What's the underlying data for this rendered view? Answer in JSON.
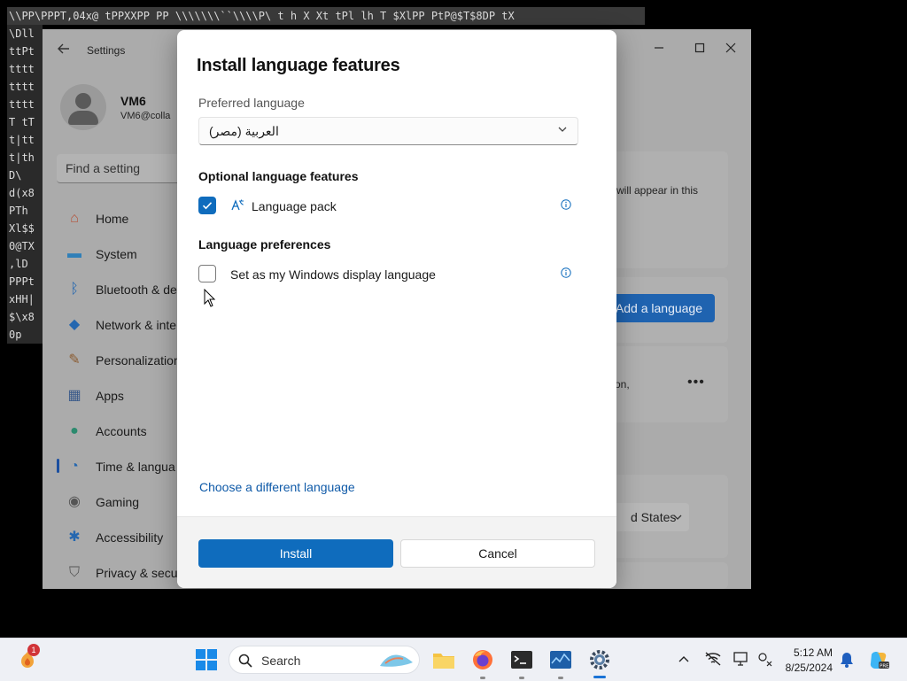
{
  "terminal": {
    "lines": [
      "\\\\PP\\PPPT,04x@ tPPXXPP PP \\\\\\\\\\\\\\``\\\\\\\\P\\ t h X Xt tPl lh T $XlPP PtP@$T$8DP tX",
      "\\Dll",
      "ttPt",
      "tttt",
      "tttt",
      "tttt",
      "T tT",
      "t|tt",
      "t|th",
      "D\\",
      "d(x8",
      "PTh",
      "Xl$$",
      "0@TX",
      ",lD",
      "PPPt",
      "xHH|",
      "$\\x8",
      "0p"
    ]
  },
  "settings": {
    "app_title": "Settings",
    "user_name": "VM6",
    "user_email": "VM6@colla",
    "find_placeholder": "Find a setting",
    "nav": [
      {
        "label": "Home",
        "icon": "home-icon"
      },
      {
        "label": "System",
        "icon": "monitor-icon"
      },
      {
        "label": "Bluetooth & de",
        "icon": "bluetooth-icon"
      },
      {
        "label": "Network & inte",
        "icon": "wifi-icon"
      },
      {
        "label": "Personalization",
        "icon": "brush-icon"
      },
      {
        "label": "Apps",
        "icon": "apps-icon"
      },
      {
        "label": "Accounts",
        "icon": "person-icon"
      },
      {
        "label": "Time & langua",
        "icon": "globe-clock-icon"
      },
      {
        "label": "Gaming",
        "icon": "gamepad-icon"
      },
      {
        "label": "Accessibility",
        "icon": "accessibility-icon"
      },
      {
        "label": "Privacy & secu",
        "icon": "shield-icon"
      }
    ],
    "selected_nav": "Time & langua",
    "card1_text_1": "will appear in this",
    "add_language_label": "Add a language",
    "card2_text": "on,",
    "region_value": "d States"
  },
  "dialog": {
    "title": "Install language features",
    "preferred_label": "Preferred language",
    "preferred_value": "العربية (مصر)",
    "optional_heading": "Optional language features",
    "language_pack_label": "Language pack",
    "language_pack_checked": true,
    "preferences_heading": "Language preferences",
    "display_language_label": "Set as my Windows display language",
    "display_language_checked": false,
    "different_language_link": "Choose a different language",
    "install_label": "Install",
    "cancel_label": "Cancel"
  },
  "taskbar": {
    "search_label": "Search",
    "notification_count": "1",
    "time": "5:12 AM",
    "date": "8/25/2024",
    "apps": [
      "widgets-icon",
      "start-icon",
      "search-icon",
      "file-explorer-icon",
      "firefox-icon",
      "terminal-icon",
      "task-manager-icon",
      "settings-icon"
    ]
  },
  "colors": {
    "accent": "#0f6cbd",
    "link": "#0f5aa8",
    "notification_badge": "#d13438"
  }
}
